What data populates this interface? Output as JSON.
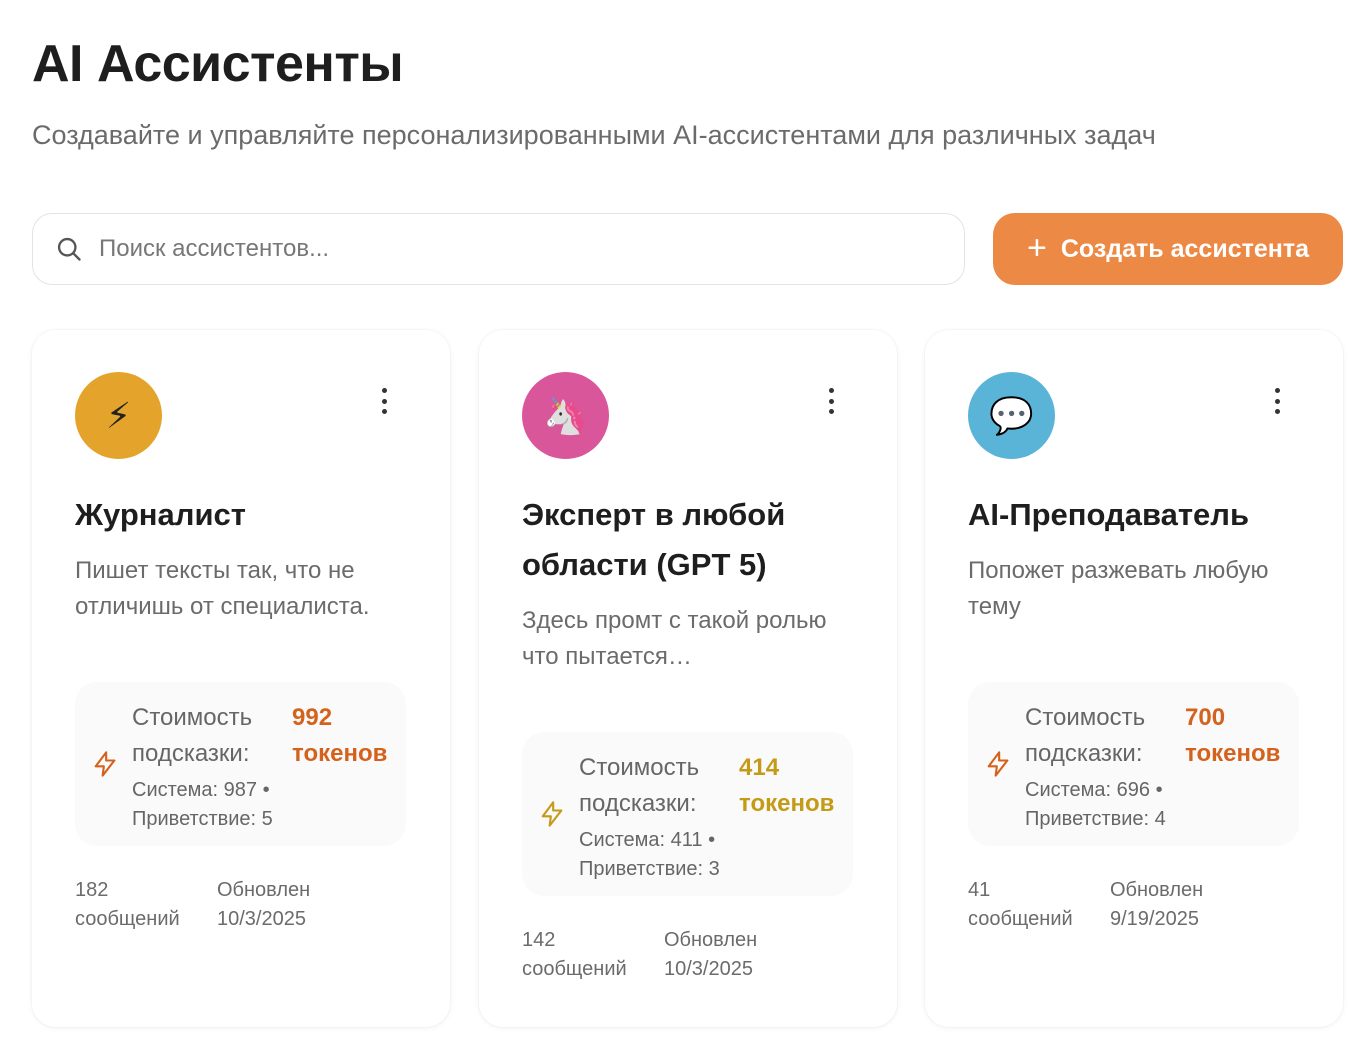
{
  "header": {
    "title": "AI Ассистенты",
    "subtitle": "Создавайте и управляйте персонализированными AI-ассистентами для различных задач"
  },
  "search": {
    "placeholder": "Поиск ассистентов..."
  },
  "create_button": {
    "icon": "plus-icon",
    "label": "Создать ассистента"
  },
  "cost_label": "Стоимость подсказки:",
  "assistants": [
    {
      "emoji": "⚡",
      "avatar_color": "#e4a42c",
      "title": "Журналист",
      "description": "Пишет тексты так, что не отличишь от специалиста.",
      "cost_value": "992 токенов",
      "cost_color": "#d4621d",
      "cost_breakdown": "Система: 987 • Приветствие: 5",
      "messages": "182 сообщений",
      "updated": "Обновлен 10/3/2025"
    },
    {
      "emoji": "🦄",
      "avatar_color": "#d9569a",
      "title": "Эксперт в любой области (GPT 5)",
      "description": "Здесь промт с такой ролью что пытается…",
      "cost_value": "414 токенов",
      "cost_color": "#c49a16",
      "cost_breakdown": "Система: 411 • Приветствие: 3",
      "messages": "142 сообщений",
      "updated": "Обновлен 10/3/2025"
    },
    {
      "emoji": "💬",
      "avatar_color": "#5ab4d8",
      "title": "AI-Преподаватель",
      "description": "Попожет разжевать любую тему",
      "cost_value": "700 токенов",
      "cost_color": "#d4621d",
      "cost_breakdown": "Система: 696 • Приветствие: 4",
      "messages": "41 сообщений",
      "updated": "Обновлен 9/19/2025"
    }
  ]
}
